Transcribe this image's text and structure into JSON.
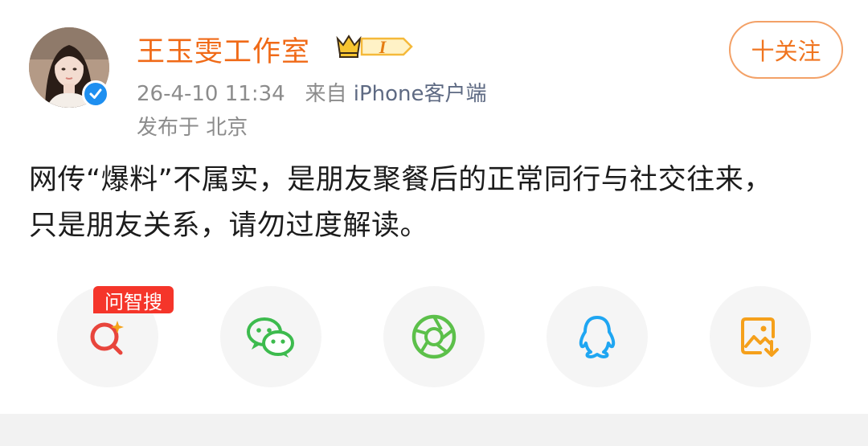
{
  "post": {
    "author_name": "王玉雯工作室",
    "vip_level": "I",
    "timestamp": "26-4-10 11:34",
    "source_prefix": "来自",
    "source": "iPhone客户端",
    "location": "发布于 北京",
    "follow_label": "十关注",
    "content_line1": "网传“爆料”不属实，是朋友聚餐后的正常同行与社交往来，",
    "content_line2": "只是朋友关系，请勿过度解读。"
  },
  "share": {
    "badge": "问智搜",
    "items": [
      {
        "icon": "ai-search-icon",
        "color": "#e8453c"
      },
      {
        "icon": "wechat-icon",
        "color": "#3dbb4e"
      },
      {
        "icon": "moments-icon",
        "color": "#5cc04a"
      },
      {
        "icon": "qq-icon",
        "color": "#1fa6f2"
      },
      {
        "icon": "save-image-icon",
        "color": "#f5a01b"
      }
    ]
  },
  "colors": {
    "author": "#f06a17",
    "follow": "#f07520",
    "meta": "#8c8c8c",
    "source": "#5e6a83",
    "verified": "#1e8ff0"
  }
}
